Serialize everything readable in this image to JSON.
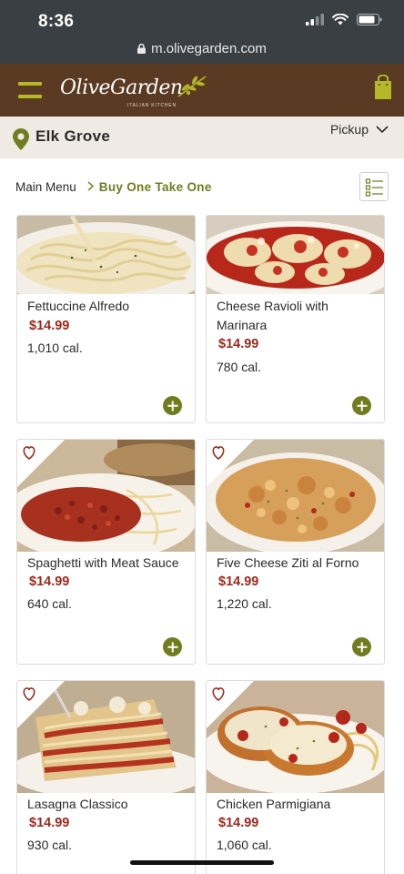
{
  "status_bar": {
    "time": "8:36"
  },
  "browser": {
    "url": "m.olivegarden.com"
  },
  "header": {
    "logo_text": "OliveGarden",
    "logo_sub": "ITALIAN KITCHEN",
    "menu_icon": "hamburger-icon",
    "bag_icon": "shopping-bag-icon",
    "brand_color": "#5a3a22",
    "accent_color": "#b5b829"
  },
  "location": {
    "name": "Elk Grove",
    "mode": "Pickup",
    "pin_icon": "map-pin-icon"
  },
  "breadcrumb": {
    "root": "Main Menu",
    "current": "Buy One Take One"
  },
  "menu_items": [
    {
      "name": "Fettuccine Alfredo",
      "price": "$14.99",
      "calories": "1,010 cal.",
      "favorite": false
    },
    {
      "name": "Cheese Ravioli with Marinara",
      "price": "$14.99",
      "calories": "780 cal.",
      "favorite": false
    },
    {
      "name": "Spaghetti with Meat Sauce",
      "price": "$14.99",
      "calories": "640 cal.",
      "favorite": true
    },
    {
      "name": "Five Cheese Ziti al Forno",
      "price": "$14.99",
      "calories": "1,220 cal.",
      "favorite": true
    },
    {
      "name": "Lasagna Classico",
      "price": "$14.99",
      "calories": "930 cal.",
      "favorite": true
    },
    {
      "name": "Chicken Parmigiana",
      "price": "$14.99",
      "calories": "1,060 cal.",
      "favorite": true
    }
  ],
  "colors": {
    "price": "#9b2a1e",
    "green": "#6f7d1f"
  }
}
